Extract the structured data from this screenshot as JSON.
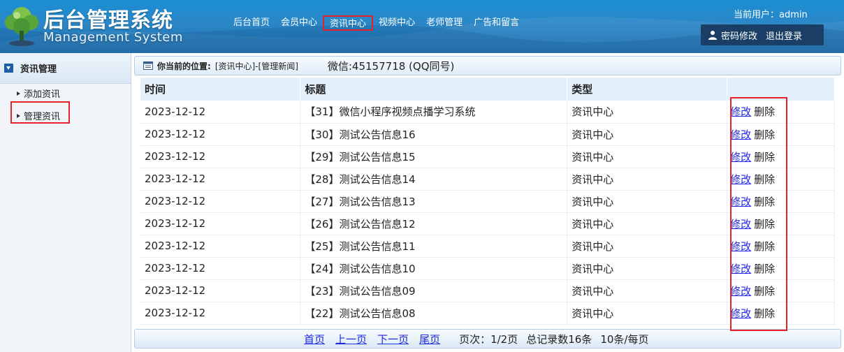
{
  "header": {
    "title": "后台管理系统",
    "subtitle": "Management System",
    "nav": [
      {
        "label": "后台首页",
        "active": false
      },
      {
        "label": "会员中心",
        "active": false
      },
      {
        "label": "资讯中心",
        "active": true
      },
      {
        "label": "视频中心",
        "active": false
      },
      {
        "label": "老师管理",
        "active": false
      },
      {
        "label": "广告和留言",
        "active": false
      }
    ],
    "current_user": "当前用户：admin",
    "change_password": "密码修改",
    "logout": "退出登录"
  },
  "sidebar": {
    "section_title": "资讯管理",
    "items": [
      {
        "label": "添加资讯"
      },
      {
        "label": "管理资讯"
      }
    ]
  },
  "breadcrumb": {
    "label": "你当前的位置:",
    "path": "[资讯中心]-[管理新闻]",
    "wechat": "微信:45157718 (QQ同号)"
  },
  "table": {
    "headers": [
      "时间",
      "标题",
      "类型",
      ""
    ],
    "edit_label": "修改",
    "delete_label": "删除",
    "rows": [
      {
        "time": "2023-12-12",
        "title": "【31】微信小程序视频点播学习系统",
        "type": "资讯中心"
      },
      {
        "time": "2023-12-12",
        "title": "【30】测试公告信息16",
        "type": "资讯中心"
      },
      {
        "time": "2023-12-12",
        "title": "【29】测试公告信息15",
        "type": "资讯中心"
      },
      {
        "time": "2023-12-12",
        "title": "【28】测试公告信息14",
        "type": "资讯中心"
      },
      {
        "time": "2023-12-12",
        "title": "【27】测试公告信息13",
        "type": "资讯中心"
      },
      {
        "time": "2023-12-12",
        "title": "【26】测试公告信息12",
        "type": "资讯中心"
      },
      {
        "time": "2023-12-12",
        "title": "【25】测试公告信息11",
        "type": "资讯中心"
      },
      {
        "time": "2023-12-12",
        "title": "【24】测试公告信息10",
        "type": "资讯中心"
      },
      {
        "time": "2023-12-12",
        "title": "【23】测试公告信息09",
        "type": "资讯中心"
      },
      {
        "time": "2023-12-12",
        "title": "【22】测试公告信息08",
        "type": "资讯中心"
      }
    ]
  },
  "pager": {
    "first": "首页",
    "prev": "上一页",
    "next": "下一页",
    "last": "尾页",
    "page_info": "页次：1/2页",
    "total": "总记录数16条",
    "per_page": "10条/每页"
  },
  "colors": {
    "header_bg": "#2c86c6",
    "highlight": "#e8202a",
    "link": "#1e2ae0",
    "table_header_bg": "#e4f1fb"
  }
}
